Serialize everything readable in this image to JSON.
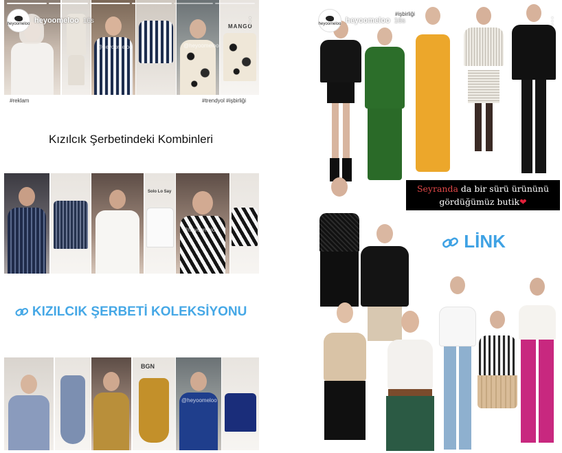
{
  "left_story": {
    "username": "heyoomeloo",
    "time": "16s",
    "avatar_text": "heyoomeloo",
    "tags": {
      "ad": "#reklam",
      "right": "#trendyol #işbirliği"
    },
    "brand_label": "MANGO",
    "watermark": "@heyoomeloo",
    "title": "Kızılcık Şerbetindeki Kombinleri",
    "collection_link": "KIZILCIK ŞERBETİ KOLEKSİYONU",
    "brand_label_2": "Solo Lo Say",
    "brand_label_3": "BGN",
    "colors": {
      "accent": "#46a8e6",
      "text": "#111111"
    }
  },
  "right_story": {
    "username": "heyoomeloo",
    "time": "16s",
    "collab_tag": "#işbirliği",
    "banner_highlight": "Seyranda",
    "banner_line1_rest": " da bir sürü ürününü",
    "banner_line2": "gördüğümüz butik",
    "link_label": "LİNK",
    "colors": {
      "link": "#3fa2e4",
      "highlight": "#e24848",
      "heart": "#e2203a"
    }
  },
  "icons": {
    "link": "link-icon",
    "heart": "heart-icon",
    "more": "more-options-icon"
  }
}
